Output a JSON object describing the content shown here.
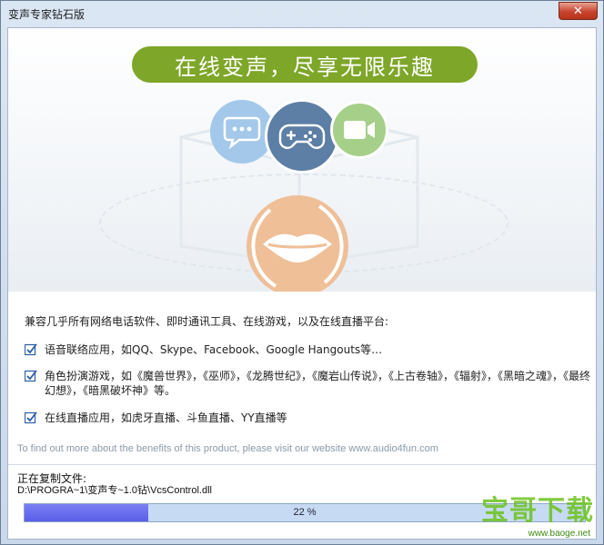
{
  "window": {
    "title": "变声专家钻石版",
    "close_label": "✕"
  },
  "hero": {
    "banner_text": "在线变声，尽享无限乐趣"
  },
  "icons": {
    "chat": "chat-icon",
    "game": "gamepad-icon",
    "video": "video-camera-icon",
    "mouth": "lips-icon"
  },
  "content": {
    "intro": "兼容几乎所有网络电话软件、即时通讯工具、在线游戏，以及在线直播平台:",
    "features": [
      {
        "text": "语音联络应用，如QQ、Skype、Facebook、Google Hangouts等…"
      },
      {
        "text": "角色扮演游戏，如《魔兽世界》，《巫师》，《龙腾世纪》，《魔岩山传说》，《上古卷轴》，《辐射》，《黑暗之魂》，《最终幻想》，《暗黑破坏神》等。"
      },
      {
        "text": "在线直播应用，如虎牙直播、斗鱼直播、YY直播等"
      }
    ],
    "website_note": "To find out more about the benefits of this product, please visit our website www.audio4fun.com"
  },
  "status": {
    "copy_label": "正在复制文件:",
    "copy_path": "D:\\PROGRA~1\\变声专~1.0钻\\VcsControl.dll",
    "progress_percent": 22,
    "progress_label": "22 %"
  },
  "watermark": {
    "text": "宝哥下载",
    "url": "www.baoge.net"
  },
  "colors": {
    "banner_green": "#7ea629",
    "progress_blue": "#5a5fe8",
    "check_blue": "#2a5ea8"
  }
}
